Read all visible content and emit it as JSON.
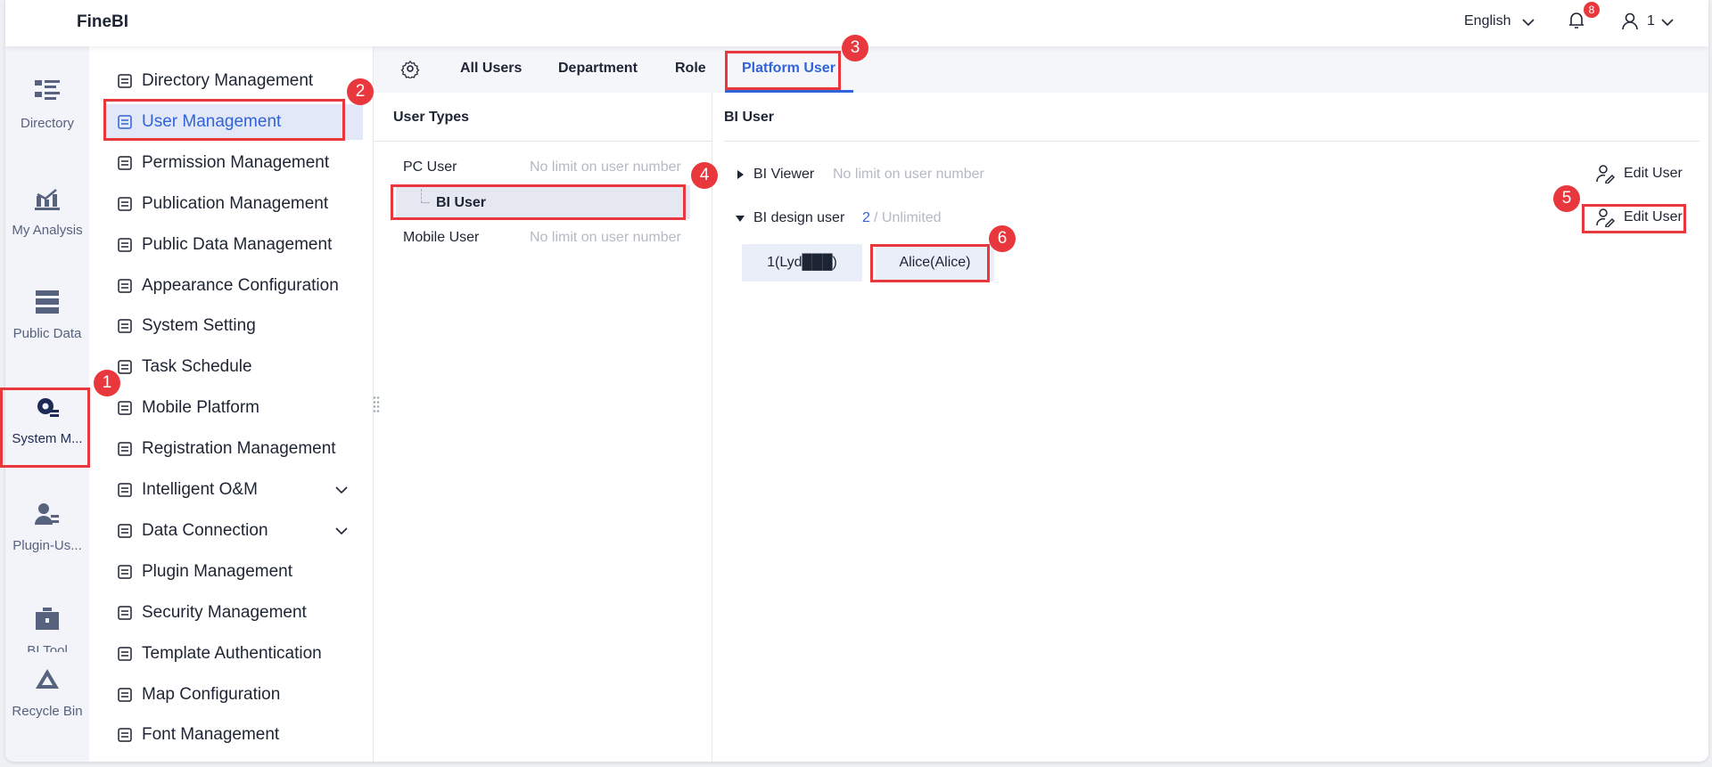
{
  "header": {
    "logo": "FineBI",
    "language": "English",
    "notification_count": "8",
    "user_name": "1"
  },
  "rail": [
    {
      "label": "Directory",
      "icon": "directory-icon"
    },
    {
      "label": "My Analysis",
      "icon": "analysis-icon"
    },
    {
      "label": "Public Data",
      "icon": "public-data-icon"
    },
    {
      "label": "System M...",
      "icon": "system-gear-icon"
    },
    {
      "label": "Plugin-Us...",
      "icon": "plugin-user-icon"
    },
    {
      "label": "BI Tool",
      "icon": "toolbox-icon"
    },
    {
      "label": "Recycle Bin",
      "icon": "recycle-bin-icon"
    }
  ],
  "menu": [
    "Directory Management",
    "User Management",
    "Permission Management",
    "Publication Management",
    "Public Data Management",
    "Appearance Configuration",
    "System Setting",
    "Task Schedule",
    "Mobile Platform",
    "Registration Management",
    "Intelligent O&M",
    "Data Connection",
    "Plugin Management",
    "Security Management",
    "Template Authentication",
    "Map Configuration",
    "Font Management"
  ],
  "tabs": [
    "All Users",
    "Department",
    "Role",
    "Platform User"
  ],
  "user_types": {
    "title": "User Types",
    "pc_user": "PC User",
    "pc_note": "No limit on user number",
    "bi_user": "BI User",
    "mobile_user": "Mobile User",
    "mobile_note": "No limit on user number"
  },
  "bi_user": {
    "title": "BI User",
    "viewer": "BI Viewer",
    "viewer_note": "No limit on user number",
    "design": "BI design user",
    "design_count": "2",
    "design_limit": "/ Unlimited",
    "edit_label": "Edit User",
    "users": [
      "1(Lyd███)",
      "Alice(Alice)"
    ]
  },
  "annotations": [
    "1",
    "2",
    "3",
    "4",
    "5",
    "6"
  ],
  "colors": {
    "accent": "#3163d9",
    "annotation": "#e8383d"
  }
}
